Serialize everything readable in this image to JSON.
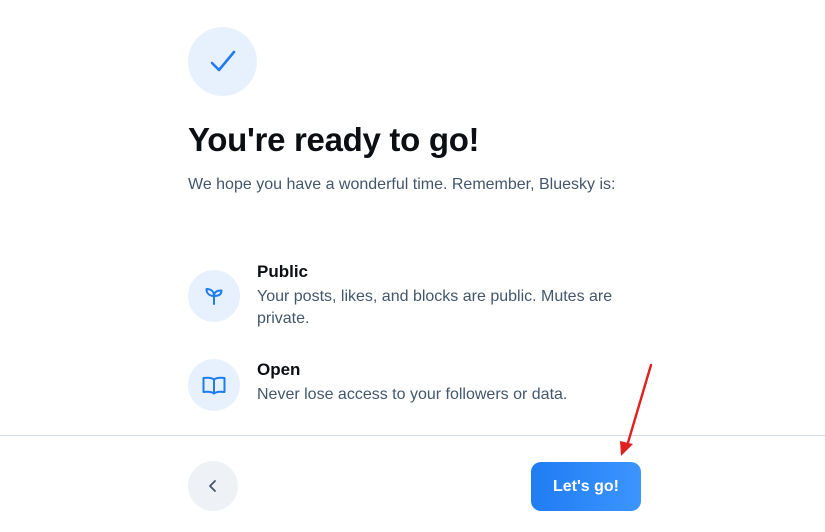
{
  "header": {
    "title": "You're ready to go!",
    "subtitle": "We hope you have a wonderful time. Remember, Bluesky is:"
  },
  "features": [
    {
      "icon": "sprout-icon",
      "title": "Public",
      "description": "Your posts, likes, and blocks are public. Mutes are private."
    },
    {
      "icon": "book-icon",
      "title": "Open",
      "description": "Never lose access to your followers or data."
    }
  ],
  "footer": {
    "back_icon": "chevron-left-icon",
    "primary_label": "Let's go!"
  },
  "colors": {
    "accent": "#1f7cf2",
    "icon_bg": "#e7f1fd",
    "annotation": "#e0201e"
  }
}
